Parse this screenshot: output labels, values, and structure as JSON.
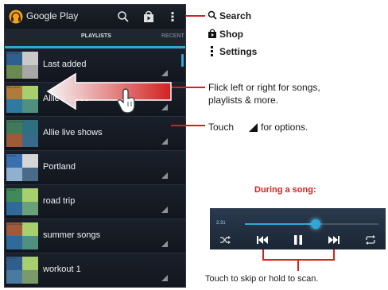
{
  "app": {
    "title": "Google Play"
  },
  "tabs": [
    {
      "label": "PLAYLISTS"
    },
    {
      "label": "RECENT"
    }
  ],
  "playlists": [
    {
      "name": "Last added",
      "thumb_title": "Last added",
      "colors": [
        "#2f5f8f",
        "#c9c9c9",
        "#6b8a52",
        "#a7a7a7"
      ]
    },
    {
      "name": "Allie's faves",
      "thumb_title": "Allie's faves",
      "colors": [
        "#b07a3a",
        "#a7cf6e",
        "#2f7aa0",
        "#4f9080"
      ]
    },
    {
      "name": "Allie live shows",
      "thumb_title": "Allie live shows",
      "colors": [
        "#3f7a5a",
        "#2f6f7f",
        "#a05a3a",
        "#3a6a8a"
      ]
    },
    {
      "name": "Portland",
      "thumb_title": "Portland",
      "colors": [
        "#3a6fb0",
        "#d5d5d5",
        "#8fb0cf",
        "#4a6a8a"
      ]
    },
    {
      "name": "road trip",
      "thumb_title": "road trip",
      "colors": [
        "#3f8a5a",
        "#a7cf6e",
        "#2f6a9a",
        "#6aa07a"
      ]
    },
    {
      "name": "summer songs",
      "thumb_title": "summer songs",
      "colors": [
        "#a05a3a",
        "#a7cf6e",
        "#2f6a9a",
        "#4f9080"
      ]
    },
    {
      "name": "workout 1",
      "thumb_title": "workout 1",
      "colors": [
        "#2f5f8f",
        "#a7cf6e",
        "#4a7aa0",
        "#7a9a6a"
      ]
    }
  ],
  "callouts": {
    "search": "Search",
    "shop": "Shop",
    "settings": "Settings",
    "flick_line1": "Flick left or right for songs,",
    "flick_line2": "playlists & more.",
    "touch_prefix": "Touch",
    "touch_suffix": "for options.",
    "during_song": "During a song:",
    "skip_scan": "Touch to skip or hold to scan."
  },
  "player": {
    "time": "2:31",
    "progress_fraction": 0.53
  },
  "colors": {
    "accent_blue": "#31a7d9",
    "callout_red": "#d42020"
  },
  "icons": [
    "headphones-icon",
    "search-icon",
    "shop-icon",
    "overflow-menu-icon",
    "shuffle-icon",
    "previous-icon",
    "pause-icon",
    "next-icon",
    "repeat-icon",
    "hand-pointer-icon",
    "options-triangle-icon"
  ]
}
